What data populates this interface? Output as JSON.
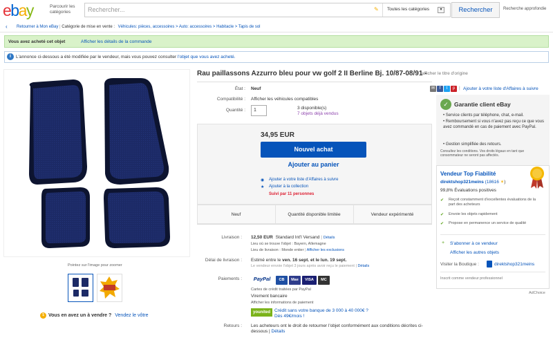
{
  "header": {
    "logo_letters": [
      "e",
      "b",
      "a",
      "y"
    ],
    "logo_colors": [
      "#e53238",
      "#0064d2",
      "#f5af02",
      "#86b817"
    ],
    "browse_label": "Parcourir les catégories",
    "search_placeholder": "Rechercher...",
    "category_label": "Toutes les catégories",
    "search_button": "Rechercher",
    "advanced_search": "Recherche approfondie"
  },
  "breadcrumb": {
    "back_label": "Retourner à Mon eBay",
    "listed_in": "Catégorie de mise en vente :",
    "path": "Véhicules: pièces, accessoires > Auto: accessoires > Habitacle > Tapis de sol"
  },
  "alerts": {
    "bought_text": "Vous avez acheté cet objet",
    "bought_link": "Afficher les détails de la commande",
    "info_text": "L'annonce ci-dessous a été modifiée par le vendeur, mais vous pouvez consulter",
    "info_link": "l'objet que vous avez acheté."
  },
  "gallery": {
    "zoom_hint": "Pointez sur l'image pour zoomer",
    "want_text": "Vous en avez un à vendre ?",
    "sell_link": "Vendez le vôtre"
  },
  "item": {
    "title": "Rau paillassons Azzurro bleu pour vw golf 2 II Berline Bj. 10/87-08/91 -",
    "title_orig_link": "afficher le titre d'origine",
    "state_label": "État :",
    "state_value": "Neuf",
    "compat_label": "Compatibilité :",
    "compat_value": "Afficher les véhicules compatibles",
    "qty_label": "Quantité :",
    "qty_value": "1",
    "available": "3 disponible(s)",
    "sold": "7 objets déjà vendus",
    "price": "34,95 EUR",
    "buy_now": "Nouvel achat",
    "add_cart": "Ajouter au panier",
    "add_watch": "Ajouter à votre liste d'Affaires à suivre",
    "add_collection": "Ajouter à la collection",
    "followers": "Suivi par 11 personnes",
    "watch_top": "Ajouter à votre liste d'Affaires à suivre"
  },
  "highlights": [
    "Neuf",
    "Quantité disponible limitée",
    "Vendeur expérimenté"
  ],
  "shipping": {
    "label": "Livraison :",
    "cost": "12,50 EUR",
    "method": "Standard Int'l Versand",
    "details": "Détails",
    "location": "Lieu où se trouve l'objet : Bayern, Allemagne",
    "ships_to": "Lieu de livraison : Monde entier",
    "exclusions": "Afficher les exclusions",
    "delivery_label": "Délai de livraison :",
    "delivery_prefix": "Estimé entre le",
    "delivery_dates": "ven. 16 sept. et le lun. 19 sept.",
    "delivery_note": "Le vendeur envoie l'objet 3 jours après avoir reçu le paiement",
    "delivery_more": "Détails"
  },
  "payments": {
    "label": "Paiements :",
    "paypal": "PayPal",
    "badges": [
      {
        "name": "card",
        "text": "CB",
        "color": "#1f4fa3"
      },
      {
        "name": "maestro",
        "text": "Mae",
        "color": "#2f3d8c"
      },
      {
        "name": "visa",
        "text": "VISA",
        "color": "#1a1f71"
      },
      {
        "name": "mastercard",
        "text": "MC",
        "color": "#333"
      }
    ],
    "card_note": "Cartes de crédit traitées par PayPal",
    "transfer": "Virement bancaire",
    "info_link": "Afficher les informations de paiement",
    "younited": "younited",
    "credit_text": "Crédit sans votre banque de 3 000 à 40 000€ ?",
    "credit_sub": "Dès 49€/mois !"
  },
  "returns": {
    "label": "Retours :",
    "text": "Les acheteurs ont le droit de retourner l'objet conformément aux conditions décrites ci-dessous |",
    "link": "Détails"
  },
  "guarantee": {
    "title": "Garantie client eBay",
    "bullets": [
      "Service clients par téléphone, chat, e-mail.",
      "Remboursement si vous n'avez pas reçu ce que vous avez commandé en cas de paiement avec PayPal.",
      "Gestion simplifiée des retours."
    ],
    "legal": "Consultez les conditions. Vos droits légaux en tant que consommateur ne seront pas affectés."
  },
  "seller": {
    "badge": "Vendeur Top Fiabilité",
    "name": "direktshop321meins",
    "score": "(18616",
    "positive": "99,8% Évaluations positives",
    "checks": [
      "Reçoit constamment d'excellentes évaluations de la part des acheteurs",
      "Envoie les objets rapidement",
      "Propose en permanence un service de qualité"
    ],
    "follow": "S'abonner à ce vendeur",
    "other_items": "Afficher les autres objets",
    "shop_label": "Visiter la Boutique :",
    "shop_name": "direktshop321meins",
    "pro": "Inscrit comme vendeur professionnel"
  },
  "footer": {
    "adchoice": "AdChoice"
  }
}
